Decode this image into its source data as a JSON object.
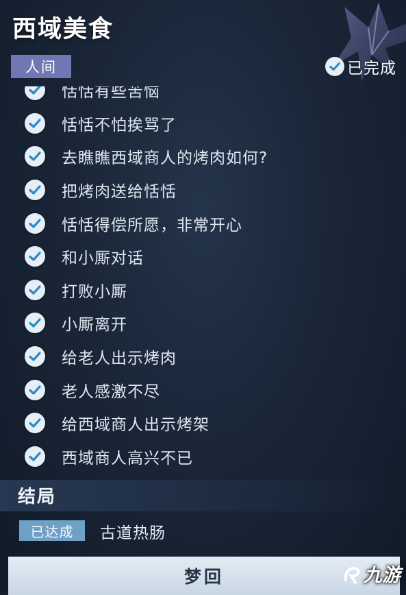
{
  "quest": {
    "title": "西域美食",
    "category": "人间",
    "status_label": "已完成"
  },
  "steps": [
    "恬恬有些苦恼",
    "恬恬不怕挨骂了",
    "去瞧瞧西域商人的烤肉如何?",
    "把烤肉送给恬恬",
    "恬恬得偿所愿，非常开心",
    "和小厮对话",
    "打败小厮",
    "小厮离开",
    "给老人出示烤肉",
    "老人感激不尽",
    "给西域商人出示烤架",
    "西域商人高兴不已"
  ],
  "ending": {
    "heading": "结局",
    "achieved_label": "已达成",
    "name": "古道热肠"
  },
  "button": {
    "label": "梦回"
  },
  "watermark": {
    "text": "九游"
  },
  "colors": {
    "category_tag": "#6f78b2",
    "achieved_tag": "#6fa0c6",
    "check_circle": "#e6eef6",
    "check_mark": "#2c89c8",
    "button": "#dfe8f1"
  },
  "icons": {
    "step_check": "check-circle-icon",
    "status_check": "check-circle-icon",
    "emblem": "butterfly-emblem-icon",
    "watermark_logo": "nine-game-logo-icon"
  }
}
